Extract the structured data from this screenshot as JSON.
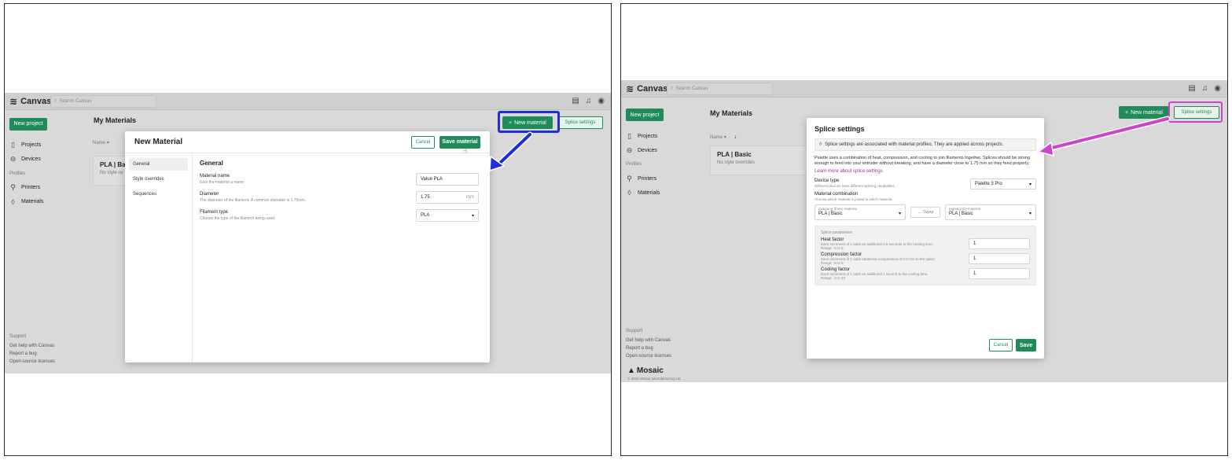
{
  "left": {
    "app_name": "Canvas",
    "search_placeholder": "Search Canvas",
    "new_project": "New project",
    "nav": {
      "projects": "Projects",
      "devices": "Devices",
      "profiles_heading": "Profiles",
      "printers": "Printers",
      "materials": "Materials"
    },
    "support": {
      "heading": "Support",
      "help": "Get help with Canvas",
      "bug": "Report a bug",
      "licenses": "Open-source licenses"
    },
    "page_title": "My Materials",
    "sort_label": "Name",
    "card_title": "PLA | Bas",
    "card_sub": "No style ov",
    "new_material_button": "New material",
    "splice_settings_button": "Splice settings",
    "modal": {
      "title": "New Material",
      "cancel": "Cancel",
      "save": "Save material",
      "tabs": [
        "General",
        "Style overrides",
        "Sequences"
      ],
      "section_title": "General",
      "fields": [
        {
          "name": "Material name",
          "hint": "Give the material a name.",
          "value": "Value PLA",
          "unit": ""
        },
        {
          "name": "Diameter",
          "hint": "The diameter of the filament. A common diameter is 1.75mm.",
          "value": "1.75",
          "unit": "mm"
        },
        {
          "name": "Filament type",
          "hint": "Choose the type of the filament being used.",
          "value": "PLA",
          "unit": ""
        }
      ]
    }
  },
  "right": {
    "app_name": "Canvas",
    "search_placeholder": "Search Canvas",
    "new_project": "New project",
    "nav": {
      "projects": "Projects",
      "devices": "Devices",
      "profiles_heading": "Profiles",
      "printers": "Printers",
      "materials": "Materials"
    },
    "support": {
      "heading": "Support",
      "help": "Get help with Canvas",
      "bug": "Report a bug",
      "licenses": "Open-source licenses"
    },
    "page_title": "My Materials",
    "sort_label": "Name",
    "card_title": "PLA | Basic",
    "card_sub": "No style overrides",
    "new_material_button": "New material",
    "splice_settings_button": "Splice settings",
    "brand": "Mosaic",
    "copyright": "© 2022 Mosaic Manufacturing Ltd.",
    "modal": {
      "title": "Splice settings",
      "notice": "Splice settings are associated with material profiles. They are applied across projects.",
      "description": "Palette uses a combination of heat, compression, and cooling to join filaments together. Splices should be strong enough to feed into your extruder without breaking, and have a diameter close to 1.75 mm so they feed properly.",
      "learn_more": "Learn more about splice settings",
      "device_type_label": "Device type",
      "device_type_hint": "Different devices have different splicing capabilities.",
      "device_type_value": "Palette 3 Pro",
      "combination_label": "Material combination",
      "combination_hint": "Choose which material is joined to which material.",
      "outgoing_caption": "Outgoing (from) material",
      "outgoing_value": "PLA | Basic",
      "swap": "Swap",
      "ingoing_caption": "Ingoing (to) material",
      "ingoing_value": "PLA | Basic",
      "params_heading": "Splice parameters",
      "params": [
        {
          "name": "Heat factor",
          "hint": "Each increment of 1 adds an additional 0.5 seconds to the heating time.",
          "range": "Range: -5 to 8",
          "value": "1"
        },
        {
          "name": "Compression factor",
          "hint": "Each increment of 1 adds additional compression of 0.5 mm to the splice.",
          "range": "Range: -6 to 6",
          "value": "1"
        },
        {
          "name": "Cooling factor",
          "hint": "Each increment of 1 adds an additional 1 second to the cooling time.",
          "range": "Range: -3 to 23",
          "value": "1"
        }
      ],
      "cancel": "Cancel",
      "save": "Save"
    }
  },
  "annotations": {
    "blue": "#1e2fd6",
    "pink": "#cc44c9"
  }
}
